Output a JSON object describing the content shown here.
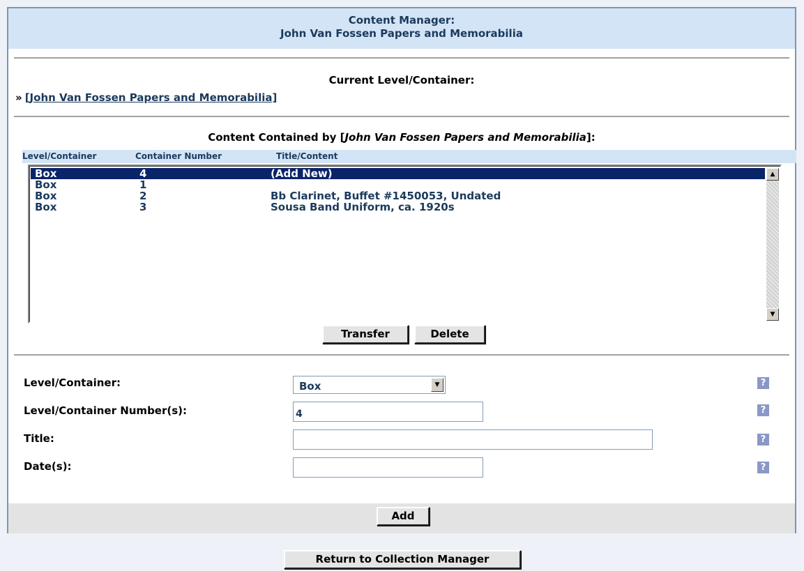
{
  "header": {
    "title_line1": "Content Manager:",
    "title_line2": "John Van Fossen Papers and Memorabilia"
  },
  "current": {
    "label": "Current Level/Container:",
    "arrow": "»",
    "link": "[John Van Fossen Papers and Memorabilia]"
  },
  "contained": {
    "prefix": "Content Contained by [",
    "name": "John Van Fossen Papers and Memorabilia",
    "suffix": "]:"
  },
  "list": {
    "columns": [
      "Level/Container",
      "Container Number",
      "Title/Content"
    ],
    "rows": [
      {
        "level": "Box",
        "number": "4",
        "title": "(Add New)",
        "selected": true
      },
      {
        "level": "Box",
        "number": "1",
        "title": ""
      },
      {
        "level": "Box",
        "number": "2",
        "title": "Bb Clarinet, Buffet #1450053, Undated"
      },
      {
        "level": "Box",
        "number": "3",
        "title": "Sousa Band Uniform, ca. 1920s"
      }
    ]
  },
  "buttons": {
    "transfer": "Transfer",
    "delete": "Delete",
    "add": "Add",
    "return": "Return to Collection Manager"
  },
  "form": {
    "level_label": "Level/Container:",
    "level_value": "Box",
    "number_label": "Level/Container Number(s):",
    "number_value": "4",
    "title_label": "Title:",
    "title_value": "",
    "dates_label": "Date(s):",
    "dates_value": ""
  },
  "icons": {
    "help": "help-icon",
    "dropdown": "chevron-down-icon",
    "scroll_up": "arrow-up-icon",
    "scroll_down": "arrow-down-icon"
  },
  "colors": {
    "header_bg": "#d3e4f6",
    "text_blue": "#1b3a5c",
    "selected_row": "#0a246a"
  }
}
